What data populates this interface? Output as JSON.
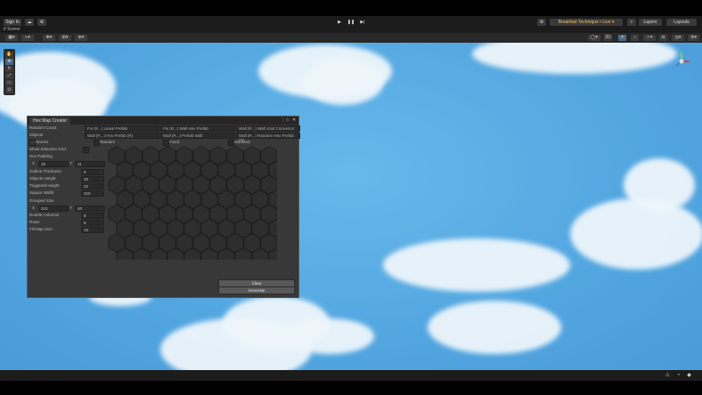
{
  "toolbar": {
    "sign_in": "Sign In",
    "cloud_icon": "cloud-icon",
    "version_control_icon": "collab-icon",
    "play_icons": [
      "play-icon",
      "pause-icon",
      "step-icon"
    ],
    "layout_label": "Layouts",
    "layers_label": "Layers",
    "account_label": "Layers",
    "project_dropdown": "Breakfast Technique • Live ▾"
  },
  "scene_tab": {
    "label": "# Scene"
  },
  "hex_window": {
    "title": "Hex Map Creator",
    "left_labels": [
      "Random Count",
      "Objects",
      "Names",
      "Show Selection Grid",
      "Hex Padding",
      "Outline Thickness",
      "Objects Height",
      "Triggered Height",
      "Square Width",
      "Grouped Size",
      "Double Columns",
      "Rows",
      "Fill Map Size"
    ],
    "padding": {
      "x_label": "X",
      "x_value": "10",
      "y_label": "Y",
      "y_value": "11"
    },
    "grouped": {
      "x_label": "X",
      "x_value": "210",
      "y_label": "Y",
      "y_value": "20"
    },
    "values": {
      "outline_thickness": "5",
      "objects_height": "20",
      "triggered_height": "22",
      "square_width": "210",
      "double_columns": "8",
      "rows": "8",
      "fill_map_size": "12"
    },
    "options_row1": [
      "Fix (R...) Lineal Prefab",
      "Fix (R...) Wall Hex Prefab",
      "Wall (R...) Wall Joint Connector"
    ],
    "options_row2": [
      "Wall (R...) Hex Prefab (R)",
      "Wall (R...) Prefab Wall",
      "Wall (R...) Random Hex Prefab (R)"
    ],
    "checkboxes": [
      "Random",
      "Fixed",
      "Mounted"
    ],
    "clear_button": "Clear",
    "generate_button": "Generate"
  },
  "colors": {
    "sky": "#56aae3",
    "panel": "#383838",
    "hex_fill": "#2e2e2e",
    "hex_stroke": "#1f1f1f"
  }
}
